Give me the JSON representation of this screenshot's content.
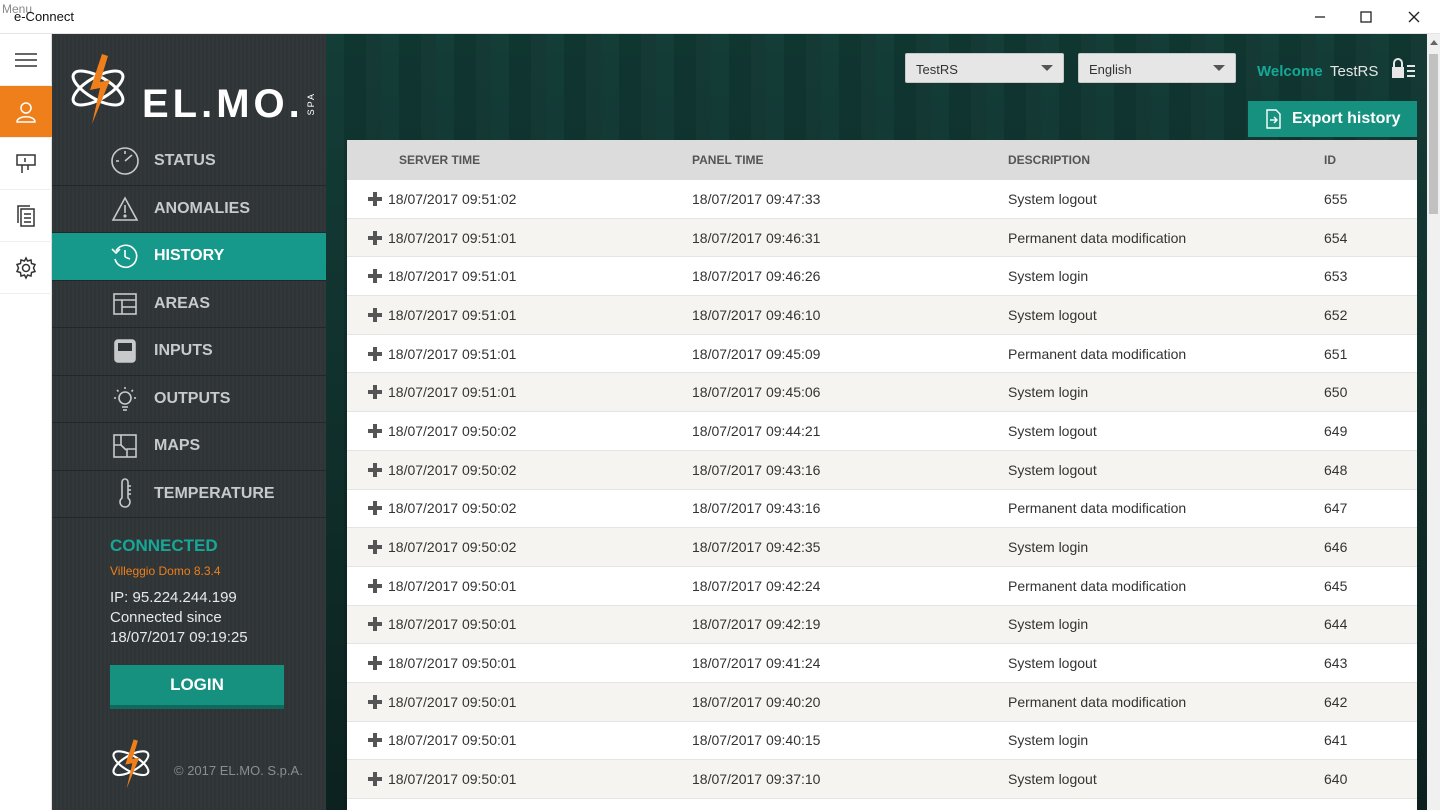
{
  "window": {
    "menu_ghost": "Menu",
    "title": "e-Connect"
  },
  "sidebar": {
    "brand": "EL.MO.",
    "brand_suffix": "SPA",
    "nav": [
      {
        "label": "STATUS",
        "icon": "gauge-icon"
      },
      {
        "label": "ANOMALIES",
        "icon": "warning-icon"
      },
      {
        "label": "HISTORY",
        "icon": "history-icon",
        "active": true
      },
      {
        "label": "AREAS",
        "icon": "areas-icon"
      },
      {
        "label": "INPUTS",
        "icon": "inputs-icon"
      },
      {
        "label": "OUTPUTS",
        "icon": "lightbulb-icon"
      },
      {
        "label": "MAPS",
        "icon": "map-icon"
      },
      {
        "label": "TEMPERATURE",
        "icon": "thermometer-icon"
      }
    ],
    "connection": {
      "status": "CONNECTED",
      "version": "Villeggio Domo 8.3.4",
      "ip": "IP: 95.224.244.199",
      "since_label": "Connected since",
      "since_value": "18/07/2017 09:19:25"
    },
    "login_label": "LOGIN",
    "copyright": "© 2017 EL.MO. S.p.A."
  },
  "header": {
    "system_select": "TestRS",
    "language_select": "English",
    "welcome": "Welcome",
    "username": "TestRS",
    "export_label": "Export history"
  },
  "table": {
    "columns": [
      "SERVER TIME",
      "PANEL TIME",
      "DESCRIPTION",
      "ID"
    ],
    "rows": [
      [
        "18/07/2017 09:51:02",
        "18/07/2017 09:47:33",
        "System logout",
        "655"
      ],
      [
        "18/07/2017 09:51:01",
        "18/07/2017 09:46:31",
        "Permanent data modification",
        "654"
      ],
      [
        "18/07/2017 09:51:01",
        "18/07/2017 09:46:26",
        "System login",
        "653"
      ],
      [
        "18/07/2017 09:51:01",
        "18/07/2017 09:46:10",
        "System logout",
        "652"
      ],
      [
        "18/07/2017 09:51:01",
        "18/07/2017 09:45:09",
        "Permanent data modification",
        "651"
      ],
      [
        "18/07/2017 09:51:01",
        "18/07/2017 09:45:06",
        "System login",
        "650"
      ],
      [
        "18/07/2017 09:50:02",
        "18/07/2017 09:44:21",
        "System logout",
        "649"
      ],
      [
        "18/07/2017 09:50:02",
        "18/07/2017 09:43:16",
        "System logout",
        "648"
      ],
      [
        "18/07/2017 09:50:02",
        "18/07/2017 09:43:16",
        "Permanent data modification",
        "647"
      ],
      [
        "18/07/2017 09:50:02",
        "18/07/2017 09:42:35",
        "System login",
        "646"
      ],
      [
        "18/07/2017 09:50:01",
        "18/07/2017 09:42:24",
        "Permanent data modification",
        "645"
      ],
      [
        "18/07/2017 09:50:01",
        "18/07/2017 09:42:19",
        "System login",
        "644"
      ],
      [
        "18/07/2017 09:50:01",
        "18/07/2017 09:41:24",
        "System logout",
        "643"
      ],
      [
        "18/07/2017 09:50:01",
        "18/07/2017 09:40:20",
        "Permanent data modification",
        "642"
      ],
      [
        "18/07/2017 09:50:01",
        "18/07/2017 09:40:15",
        "System login",
        "641"
      ],
      [
        "18/07/2017 09:50:01",
        "18/07/2017 09:37:10",
        "System logout",
        "640"
      ]
    ]
  },
  "colors": {
    "accent_teal": "#16998b",
    "accent_orange": "#ef7f1a",
    "sidebar_bg": "#2f3437"
  }
}
